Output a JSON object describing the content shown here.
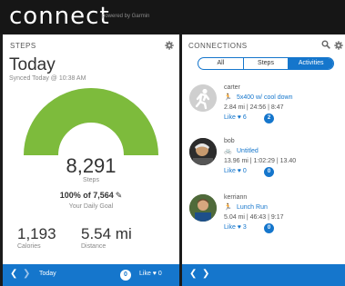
{
  "header": {
    "logo": "connect",
    "powered_by": "powered by Garmin"
  },
  "steps_panel": {
    "title": "STEPS",
    "heading": "Today",
    "synced": "Synced Today @ 10:38 AM",
    "steps_value": "8,291",
    "steps_label": "Steps",
    "goal_percent_text": "100% of 7,564",
    "goal_fraction": 1.0,
    "goal_label": "Your Daily Goal",
    "calories_value": "1,193",
    "calories_label": "Calories",
    "distance_value": "5.54 mi",
    "distance_label": "Distance",
    "gauge_color": "#7dbb3c"
  },
  "steps_footer": {
    "day_label": "Today",
    "comment_count": "0",
    "like_label": "Like",
    "like_count": "0"
  },
  "connections_panel": {
    "title": "CONNECTIONS",
    "tabs": [
      "All",
      "Steps",
      "Activities"
    ],
    "active_tab": "Activities",
    "items": [
      {
        "name": "carter",
        "activity": "5x400 w/ cool down",
        "activity_icon": "running-icon",
        "stats": "2.84 mi | 24:56 | 8:47",
        "like_label": "Like",
        "likes": "6",
        "comments": "2"
      },
      {
        "name": "bob",
        "activity": "Untitled",
        "activity_icon": "cycling-icon",
        "stats": "13.96 mi | 1:02:29 | 13.40",
        "like_label": "Like",
        "likes": "0",
        "comments": "0"
      },
      {
        "name": "kerriann",
        "activity": "Lunch Run",
        "activity_icon": "running-icon",
        "stats": "5.04 mi | 46:43 | 9:17",
        "like_label": "Like",
        "likes": "3",
        "comments": "0"
      }
    ]
  },
  "colors": {
    "accent": "#1576cc",
    "gauge_green": "#7dbb3c",
    "gauge_track": "#e6e6e6"
  }
}
